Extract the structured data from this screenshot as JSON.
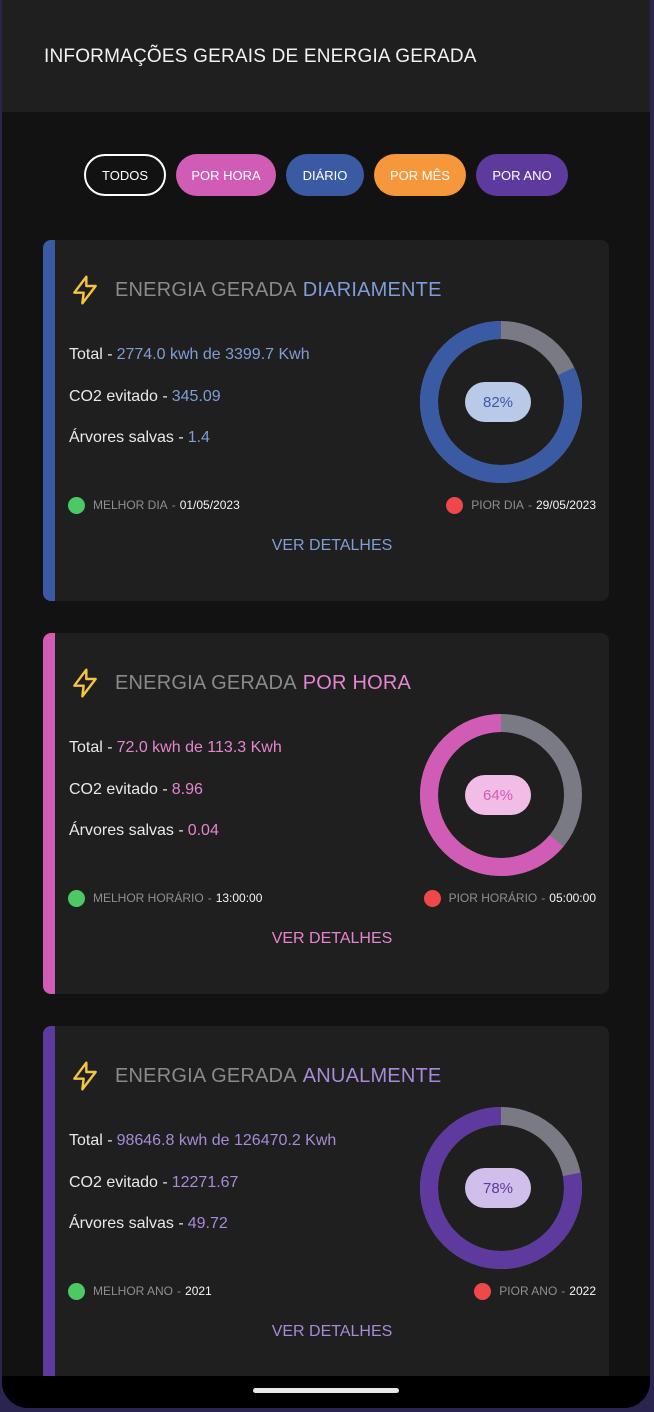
{
  "header": {
    "title": "INFORMAÇÕES GERAIS DE ENERGIA GERADA"
  },
  "filters": [
    {
      "label": "TODOS",
      "color": "#121212"
    },
    {
      "label": "POR HORA",
      "color": "#d15cb5"
    },
    {
      "label": "DIÁRIO",
      "color": "#3a5ba4"
    },
    {
      "label": "POR MÊS",
      "color": "#f5973a"
    },
    {
      "label": "POR ANO",
      "color": "#5e3a9e"
    }
  ],
  "cards": [
    {
      "title_prefix": "ENERGIA GERADA",
      "title_accent": "DIARIAMENTE",
      "accent_color": "#3a5ba4",
      "text_color": "#7f9dd6",
      "total_label": "Total -",
      "total_value": "2774.0 kwh de 3399.7 Kwh",
      "co2_label": "CO2 evitado -",
      "co2_value": "345.09",
      "trees_label": "Árvores salvas -",
      "trees_value": "1.4",
      "percent": "82%",
      "percent_value": 82,
      "best_label": "MELHOR DIA",
      "best_value": "01/05/2023",
      "worst_label": "PIOR DIA",
      "worst_value": "29/05/2023",
      "details_label": "VER DETALHES"
    },
    {
      "title_prefix": "ENERGIA GERADA",
      "title_accent": "POR HORA",
      "accent_color": "#d15cb5",
      "text_color": "#e685cf",
      "total_label": "Total -",
      "total_value": "72.0 kwh de 113.3 Kwh",
      "co2_label": "CO2 evitado -",
      "co2_value": "8.96",
      "trees_label": "Árvores salvas -",
      "trees_value": "0.04",
      "percent": "64%",
      "percent_value": 64,
      "best_label": "MELHOR HORÁRIO",
      "best_value": "13:00:00",
      "worst_label": "PIOR HORÁRIO",
      "worst_value": "05:00:00",
      "details_label": "VER DETALHES"
    },
    {
      "title_prefix": "ENERGIA GERADA",
      "title_accent": "ANUALMENTE",
      "accent_color": "#5e3a9e",
      "text_color": "#a88ad8",
      "total_label": "Total -",
      "total_value": "98646.8 kwh de 126470.2 Kwh",
      "co2_label": "CO2 evitado -",
      "co2_value": "12271.67",
      "trees_label": "Árvores salvas -",
      "trees_value": "49.72",
      "percent": "78%",
      "percent_value": 78,
      "best_label": "MELHOR ANO",
      "best_value": "2021",
      "worst_label": "PIOR ANO",
      "worst_value": "2022",
      "details_label": "VER DETALHES"
    }
  ],
  "colors": {
    "best_dot": "#4cc964",
    "worst_dot": "#f0474b",
    "ring_track": "#7a7a85"
  }
}
